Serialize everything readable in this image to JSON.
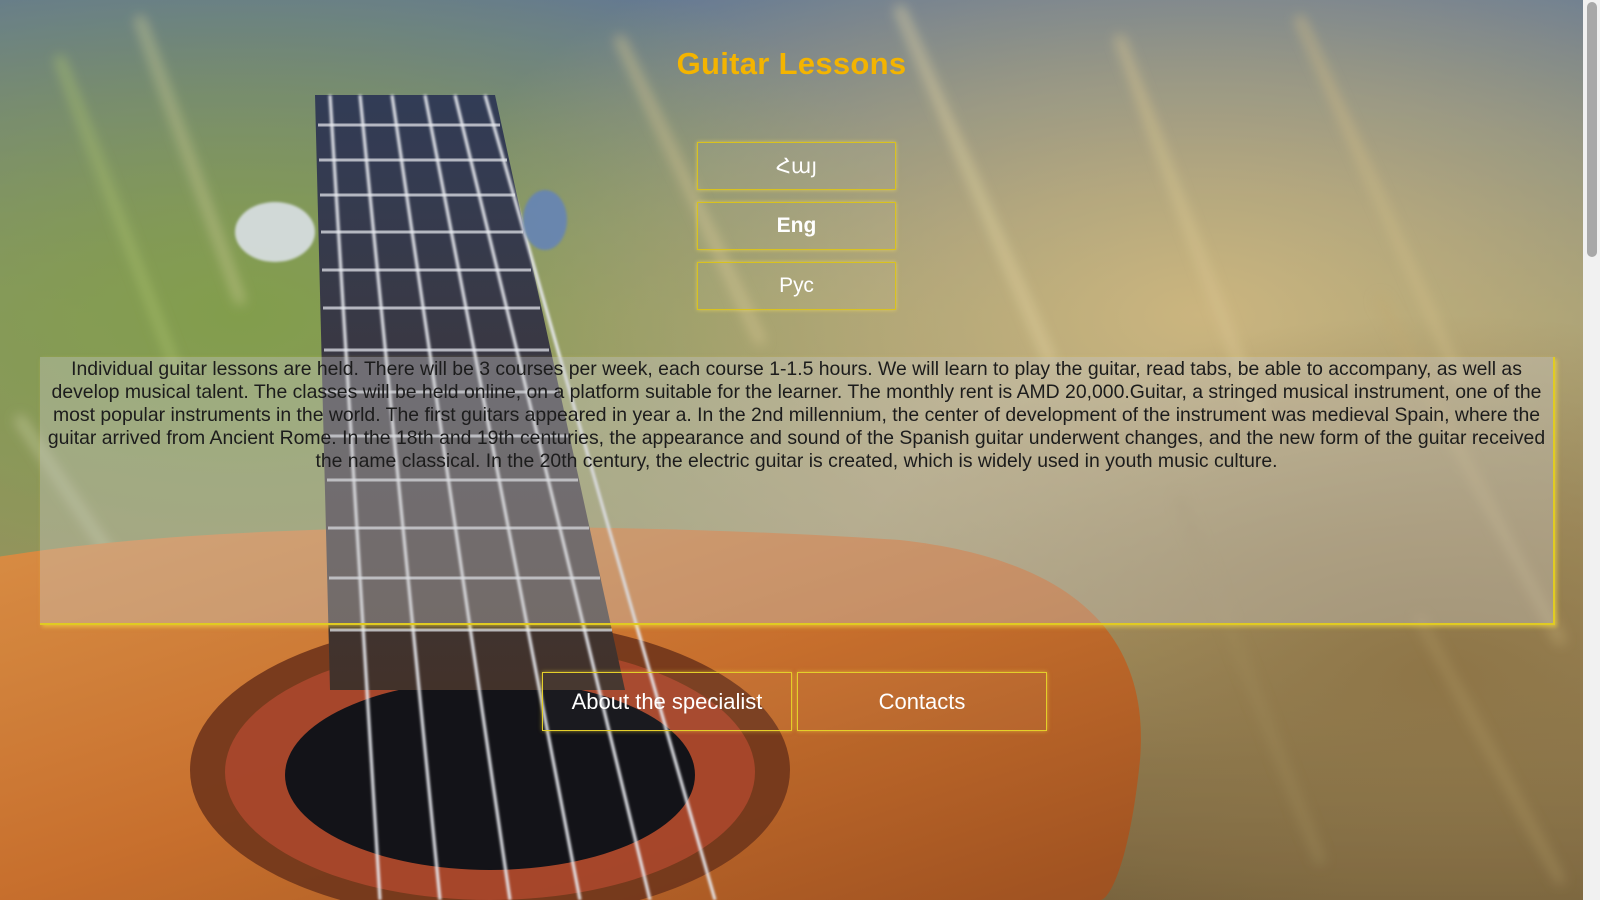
{
  "page": {
    "title": "Guitar Lessons"
  },
  "languages": [
    {
      "label": "Հայ",
      "active": false
    },
    {
      "label": "Eng",
      "active": true
    },
    {
      "label": "Рус",
      "active": false
    }
  ],
  "content": {
    "text": "Individual guitar lessons are held. There will be 3 courses per week, each course 1-1.5 hours. We will learn to play the guitar, read tabs, be able to accompany, as well as develop musical talent. The classes will be held online, on a platform suitable for the learner. The monthly rent is AMD 20,000.Guitar, a stringed musical instrument, one of the most popular instruments in the world. The first guitars appeared in year a. In the 2nd millennium, the center of development of the instrument was medieval Spain, where the guitar arrived from Ancient Rome. In the 18th and 19th centuries, the appearance and sound of the Spanish guitar underwent changes, and the new form of the guitar received the name classical. In the 20th century, the electric guitar is created, which is widely used in youth music culture."
  },
  "nav": {
    "about_label": "About the specialist",
    "contacts_label": "Contacts"
  },
  "colors": {
    "title": "#f4b400",
    "border_accent": "#e0cb22",
    "button_text": "#ffffff",
    "body_text": "#1c1c1c"
  },
  "background": {
    "icon": "guitar-on-grass-photo"
  }
}
